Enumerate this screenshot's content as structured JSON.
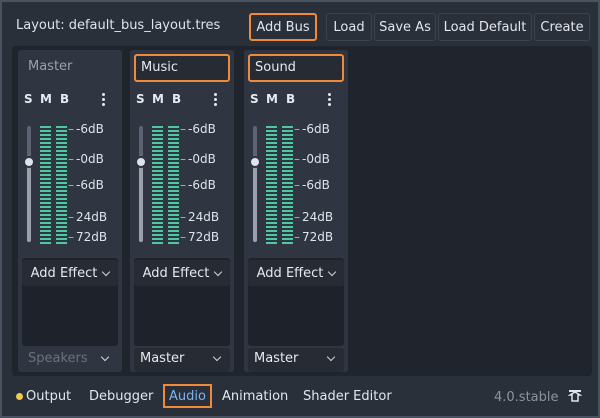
{
  "header": {
    "layout_label": "Layout: default_bus_layout.tres",
    "buttons": [
      "Add Bus",
      "Load",
      "Save As",
      "Load Default",
      "Create"
    ]
  },
  "strip_controls": {
    "solo": "S",
    "mute": "M",
    "bypass": "B"
  },
  "db_scale": [
    "-6dB",
    "-0dB",
    "-6dB",
    "24dB",
    "72dB"
  ],
  "buses": [
    {
      "name": "Master",
      "add_effect": "Add Effect",
      "output": "Speakers"
    },
    {
      "name": "Music",
      "add_effect": "Add Effect",
      "output": "Master"
    },
    {
      "name": "Sound",
      "add_effect": "Add Effect",
      "output": "Master"
    }
  ],
  "bottom_panel": {
    "tabs": [
      "Output",
      "Debugger",
      "Audio",
      "Animation",
      "Shader Editor"
    ],
    "version": "4.0.stable"
  },
  "colors": {
    "accent": "#ef8a3a",
    "meter_green": "#4fc7a0",
    "active_tab": "#7db3f0",
    "output_dot": "#f5c94a"
  },
  "icons": [
    "kebab-menu-icon",
    "chevron-down-icon",
    "pin-panel-icon"
  ]
}
